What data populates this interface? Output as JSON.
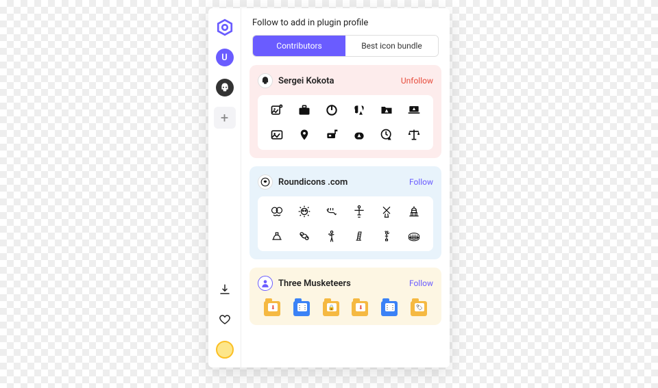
{
  "header": {
    "title": "Follow to add in plugin profile"
  },
  "tabs": [
    {
      "label": "Contributors",
      "active": true
    },
    {
      "label": "Best icon bundle",
      "active": false
    }
  ],
  "sidebar": {
    "user_initial": "U",
    "add_glyph": "+"
  },
  "cards": [
    {
      "name": "Sergei Kokota",
      "action_label": "Unfollow",
      "action_type": "unfollow",
      "bg": "pink",
      "icons": [
        "image-minus-icon",
        "briefcase-icon",
        "power-icon",
        "brain-warning-icon",
        "folder-warning-icon",
        "laptop-warning-icon",
        "image-icon",
        "location-pin-icon",
        "mailbox-icon",
        "warning-badge-icon",
        "clock-alert-icon",
        "scale-icon"
      ]
    },
    {
      "name": "Roundicons .com",
      "action_label": "Follow",
      "action_type": "follow",
      "bg": "blue",
      "icons": [
        "faces-icon",
        "lion-icon",
        "scorpion-icon",
        "christ-statue-icon",
        "windmill-icon",
        "capitol-icon",
        "sphinx-icon",
        "cancer-sign-icon",
        "archer-icon",
        "pisa-tower-icon",
        "liberty-statue-icon",
        "colosseum-icon"
      ]
    },
    {
      "name": "Three Musketeers",
      "action_label": "Follow",
      "action_type": "follow",
      "bg": "cream",
      "icons": [
        "folder-download-yellow-icon",
        "folder-zip-blue-icon",
        "folder-lock-yellow-icon",
        "folder-download-yellow-icon",
        "folder-zip-blue-icon",
        "folder-tag-yellow-icon"
      ]
    }
  ]
}
